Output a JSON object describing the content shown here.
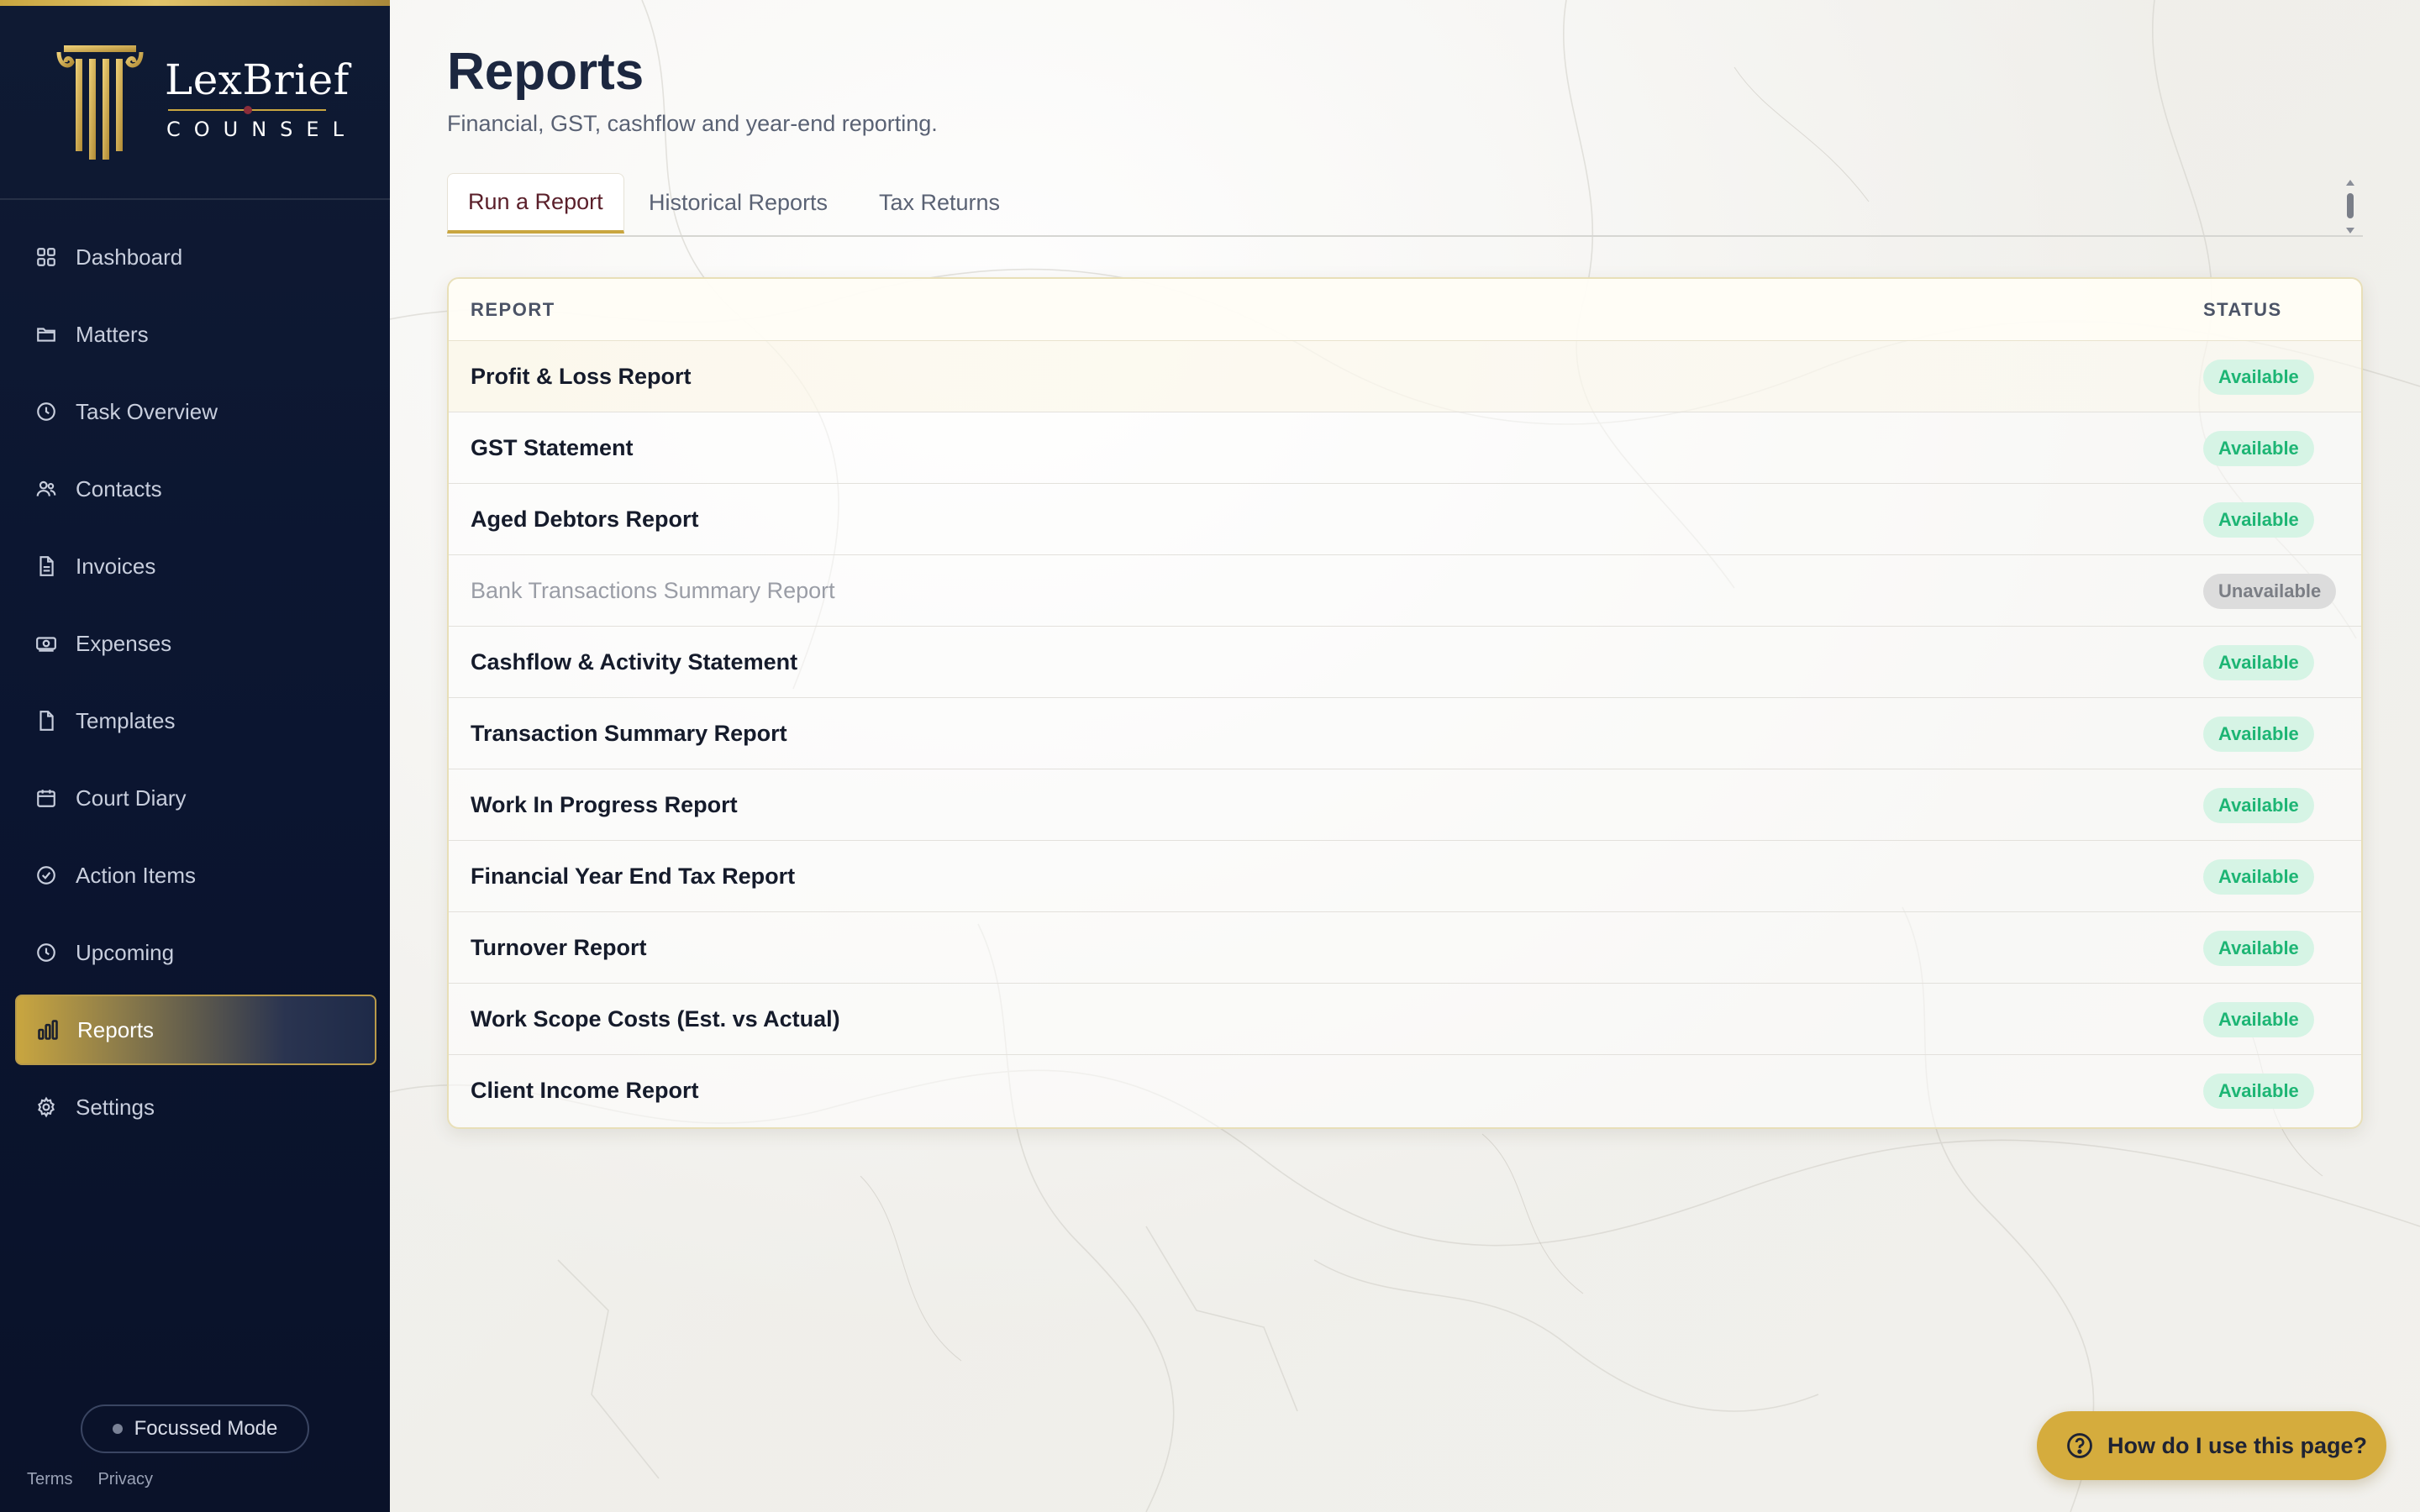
{
  "brand": {
    "name": "LexBrief",
    "sub": "COUNSEL",
    "gold": "#c9a640",
    "navy": "#0f1a33"
  },
  "sidebar": {
    "items": [
      {
        "label": "Dashboard",
        "icon": "grid-icon"
      },
      {
        "label": "Matters",
        "icon": "folder-icon"
      },
      {
        "label": "Task Overview",
        "icon": "clock-icon"
      },
      {
        "label": "Contacts",
        "icon": "users-icon"
      },
      {
        "label": "Invoices",
        "icon": "document-icon"
      },
      {
        "label": "Expenses",
        "icon": "money-icon"
      },
      {
        "label": "Templates",
        "icon": "file-icon"
      },
      {
        "label": "Court Diary",
        "icon": "calendar-icon"
      },
      {
        "label": "Action Items",
        "icon": "check-circle-icon"
      },
      {
        "label": "Upcoming",
        "icon": "clock-icon"
      },
      {
        "label": "Reports",
        "icon": "bar-chart-icon",
        "active": true
      },
      {
        "label": "Settings",
        "icon": "gear-icon"
      }
    ],
    "focus_mode": "Focussed Mode",
    "footer": {
      "terms": "Terms",
      "privacy": "Privacy"
    }
  },
  "page": {
    "title": "Reports",
    "subtitle": "Financial, GST, cashflow and year-end reporting."
  },
  "tabs": [
    {
      "label": "Run a Report",
      "active": true
    },
    {
      "label": "Historical Reports"
    },
    {
      "label": "Tax Returns"
    }
  ],
  "table": {
    "headers": {
      "report": "REPORT",
      "status": "STATUS"
    },
    "rows": [
      {
        "name": "Profit & Loss Report",
        "status": "Available"
      },
      {
        "name": "GST Statement",
        "status": "Available"
      },
      {
        "name": "Aged Debtors Report",
        "status": "Available"
      },
      {
        "name": "Bank Transactions Summary Report",
        "status": "Unavailable"
      },
      {
        "name": "Cashflow & Activity Statement",
        "status": "Available"
      },
      {
        "name": "Transaction Summary Report",
        "status": "Available"
      },
      {
        "name": "Work In Progress Report",
        "status": "Available"
      },
      {
        "name": "Financial Year End Tax Report",
        "status": "Available"
      },
      {
        "name": "Turnover Report",
        "status": "Available"
      },
      {
        "name": "Work Scope Costs (Est. vs Actual)",
        "status": "Available"
      },
      {
        "name": "Client Income Report",
        "status": "Available"
      }
    ]
  },
  "help": {
    "label": "How do I use this page?",
    "icon": "question-circle-icon"
  }
}
